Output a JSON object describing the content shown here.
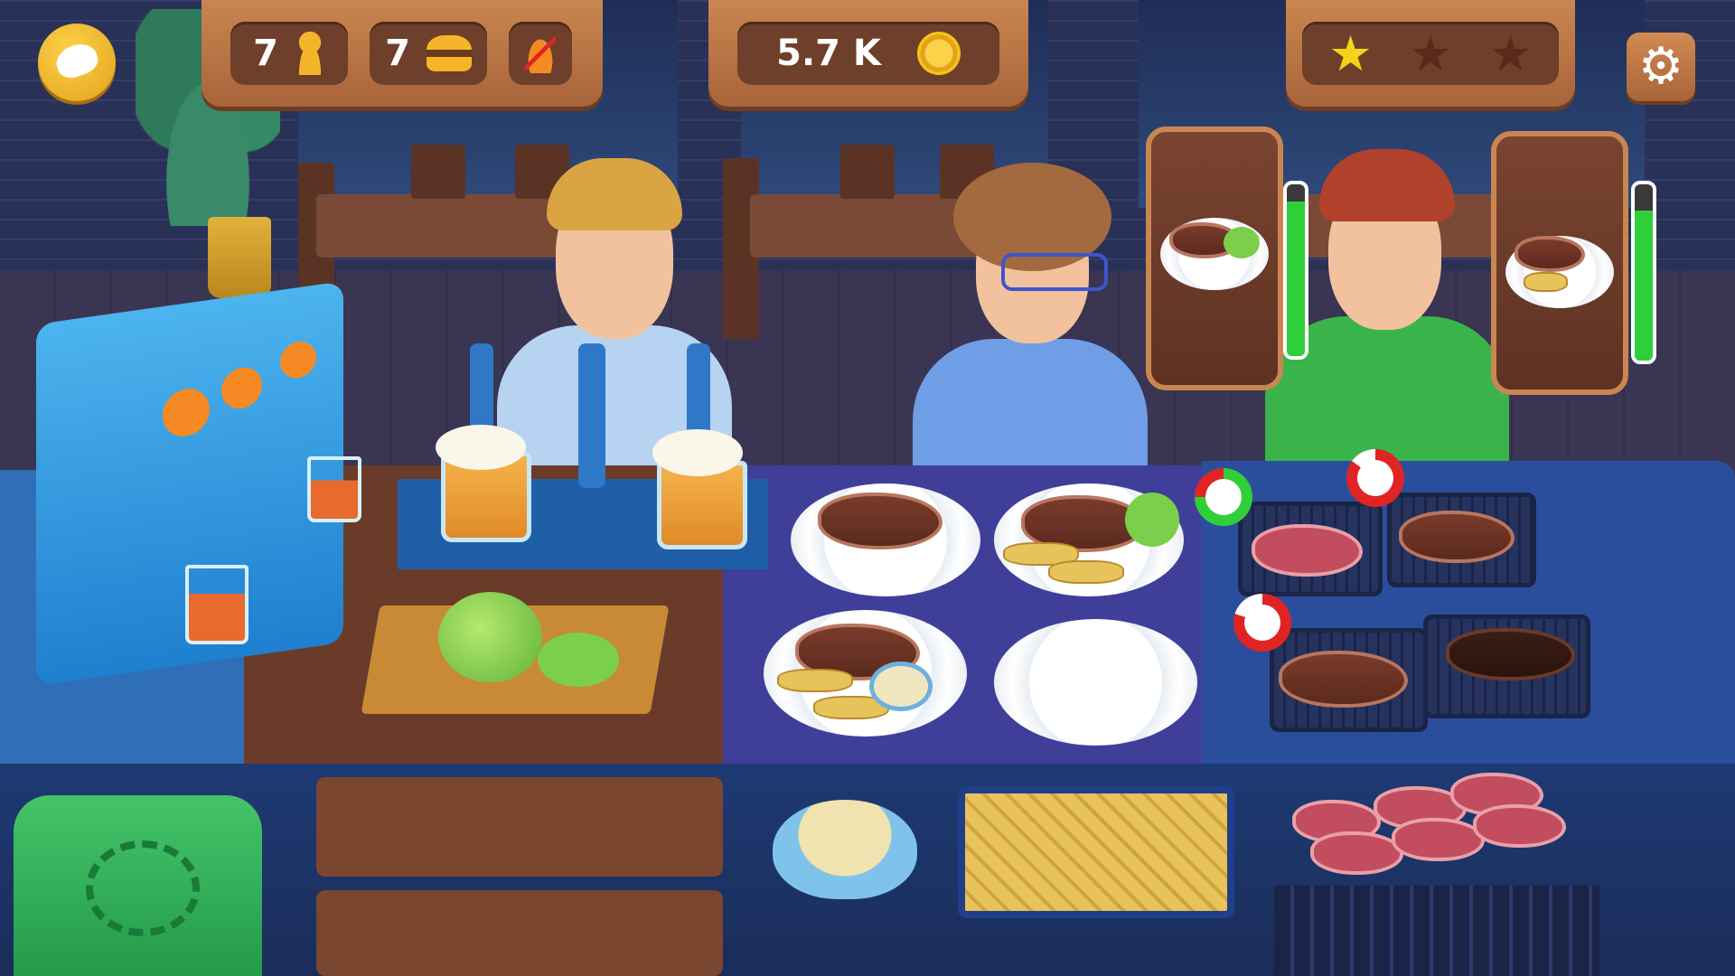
{
  "hud": {
    "customers_count": "7",
    "customer_icon": "person-icon",
    "burgers_count": "7",
    "burger_icon": "burger-icon",
    "no_fire_icon": "no-fire-icon",
    "coins": "5.7 K",
    "coin_icon": "coin-icon",
    "stars_earned": 1,
    "stars_total": 3,
    "settings_icon": "gear-icon",
    "menu_icon": "bread-icon"
  },
  "customers": [
    {
      "name": "blond-man"
    },
    {
      "name": "woman-glasses",
      "order": "steak-with-lettuce",
      "patience": 0.9
    },
    {
      "name": "man-green-shirt",
      "order": "steak-with-fries",
      "patience": 0.85
    }
  ],
  "stations": {
    "juice_dispenser": {
      "glasses": 2
    },
    "beer_tap": {
      "mugs": 2
    },
    "plates": [
      "steak",
      "steak-fries-lettuce",
      "steak-fries-sauce",
      "empty"
    ],
    "grill": [
      {
        "item": "raw-steak",
        "progress": 0.75
      },
      {
        "item": "cooked-steak",
        "progress": 0.15
      },
      {
        "item": "cooked-steak",
        "progress": 0.2
      },
      {
        "item": "burnt-steak"
      }
    ],
    "supplies": [
      "sauce-bowl",
      "fries-tray",
      "raw-steaks"
    ]
  },
  "colors": {
    "accent": "#c98650",
    "meter_green": "#2fcf3a",
    "timer_red": "#e02424",
    "timer_green": "#2fcf3a",
    "coin": "#f5c21a",
    "star_active": "#f7d21c",
    "star_inactive": "#5a2a1a"
  }
}
